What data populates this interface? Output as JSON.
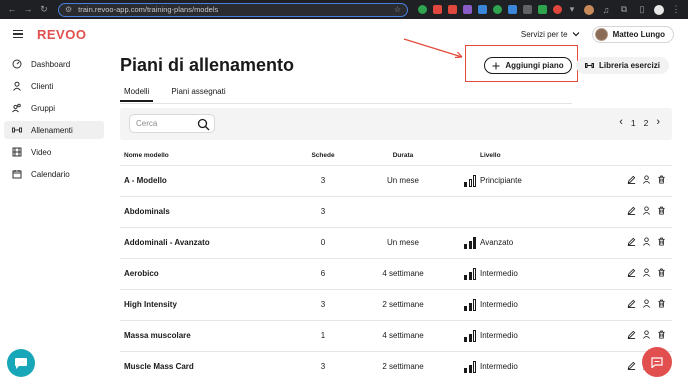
{
  "browser": {
    "url": "train.revoo-app.com/training-plans/models",
    "colors": {
      "accent": "#4a7fe0"
    }
  },
  "header": {
    "brand": "REVOO",
    "services_label": "Servizi per te",
    "user_name": "Matteo Lungo"
  },
  "sidebar": {
    "items": [
      {
        "label": "Dashboard",
        "icon": "speedometer-icon"
      },
      {
        "label": "Clienti",
        "icon": "user-icon"
      },
      {
        "label": "Gruppi",
        "icon": "group-icon"
      },
      {
        "label": "Allenamenti",
        "icon": "dumbbell-icon",
        "active": true
      },
      {
        "label": "Video",
        "icon": "film-icon"
      },
      {
        "label": "Calendario",
        "icon": "calendar-icon"
      }
    ]
  },
  "main": {
    "title": "Piani di allenamento",
    "add_plan_label": "Aggiungi piano",
    "library_label": "Libreria esercizi",
    "tabs": [
      {
        "label": "Modelli",
        "active": true
      },
      {
        "label": "Piani assegnati",
        "active": false
      }
    ],
    "search_placeholder": "Cerca",
    "pager": {
      "page_1": "1",
      "page_2": "2"
    },
    "table": {
      "headers": {
        "name": "Nome modello",
        "schede": "Schede",
        "durata": "Durata",
        "livello": "Livello"
      },
      "rows": [
        {
          "name": "A - Modello",
          "schede": "3",
          "durata": "Un mese",
          "livello": "Principiante",
          "level": 1
        },
        {
          "name": "Abdominals",
          "schede": "3",
          "durata": "",
          "livello": "",
          "level": 0
        },
        {
          "name": "Addominali - Avanzato",
          "schede": "0",
          "durata": "Un mese",
          "livello": "Avanzato",
          "level": 3
        },
        {
          "name": "Aerobico",
          "schede": "6",
          "durata": "4 settimane",
          "livello": "Intermedio",
          "level": 2
        },
        {
          "name": "High Intensity",
          "schede": "3",
          "durata": "2 settimane",
          "livello": "Intermedio",
          "level": 2
        },
        {
          "name": "Massa muscolare",
          "schede": "1",
          "durata": "4 settimane",
          "livello": "Intermedio",
          "level": 2
        },
        {
          "name": "Muscle Mass Card",
          "schede": "3",
          "durata": "2 settimane",
          "livello": "Intermedio",
          "level": 2
        }
      ]
    }
  },
  "colors": {
    "brand": "#e24f4f",
    "highlight": "#e14b3b",
    "chat_support": "#18a7b8",
    "chat_feedback": "#e24f4f"
  }
}
